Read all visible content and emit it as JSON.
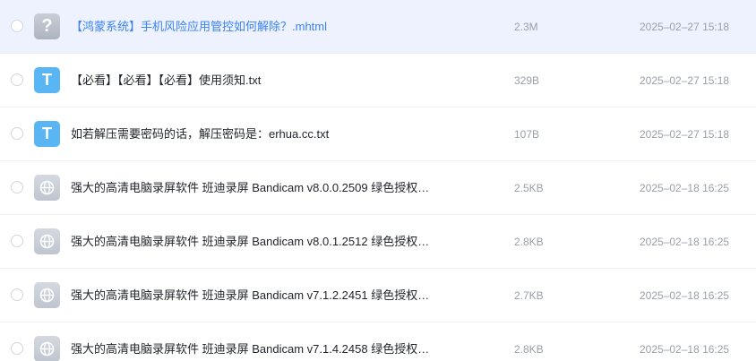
{
  "files": [
    {
      "icon": "unknown-file-icon",
      "glyph": "?",
      "name": "【鸿蒙系统】手机风险应用管控如何解除？.mhtml",
      "size": "2.3M",
      "date": "2025–02–27 15:18",
      "hovered": true
    },
    {
      "icon": "text-file-icon",
      "glyph": "T",
      "name": "【必看】【必看】【必看】使用须知.txt",
      "size": "329B",
      "date": "2025–02–27 15:18",
      "hovered": false
    },
    {
      "icon": "text-file-icon",
      "glyph": "T",
      "name": "如若解压需要密码的话，解压密码是：erhua.cc.txt",
      "size": "107B",
      "date": "2025–02–27 15:18",
      "hovered": false
    },
    {
      "icon": "web-file-icon",
      "glyph": "",
      "name": "强大的高清电脑录屏软件 班迪录屏 Bandicam v8.0.0.2509 绿色授权…",
      "size": "2.5KB",
      "date": "2025–02–18 16:25",
      "hovered": false
    },
    {
      "icon": "web-file-icon",
      "glyph": "",
      "name": "强大的高清电脑录屏软件 班迪录屏 Bandicam v8.0.1.2512 绿色授权…",
      "size": "2.8KB",
      "date": "2025–02–18 16:25",
      "hovered": false
    },
    {
      "icon": "web-file-icon",
      "glyph": "",
      "name": "强大的高清电脑录屏软件 班迪录屏 Bandicam v7.1.2.2451 绿色授权…",
      "size": "2.7KB",
      "date": "2025–02–18 16:25",
      "hovered": false
    },
    {
      "icon": "web-file-icon",
      "glyph": "",
      "name": "强大的高清电脑录屏软件 班迪录屏 Bandicam v7.1.4.2458 绿色授权…",
      "size": "2.8KB",
      "date": "2025–02–18 16:25",
      "hovered": false
    }
  ]
}
